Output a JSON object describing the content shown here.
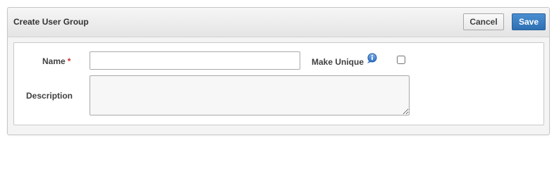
{
  "dialog": {
    "title": "Create User Group",
    "cancel_label": "Cancel",
    "save_label": "Save"
  },
  "form": {
    "name_label": "Name",
    "required_marker": "*",
    "name_value": "",
    "make_unique_label": "Make Unique",
    "make_unique_checked": false,
    "help_icon": "info-icon",
    "description_label": "Description",
    "description_value": ""
  },
  "colors": {
    "save_button": "#2e6fb3",
    "required_marker": "#d03030",
    "info_icon": "#2f6fc4"
  }
}
